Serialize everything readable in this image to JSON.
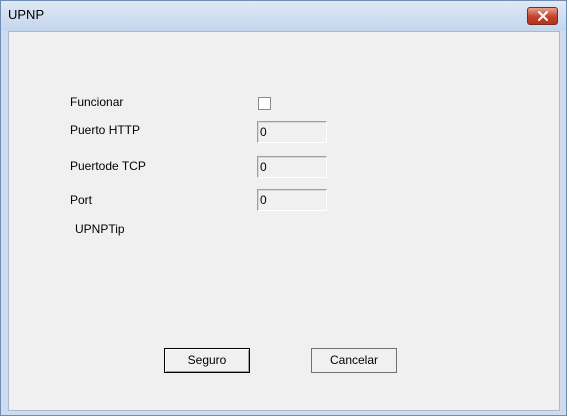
{
  "window": {
    "title": "UPNP",
    "close_icon": "close-icon"
  },
  "form": {
    "enable_label": "Funcionar",
    "enable_checked": false,
    "http_port_label": "Puerto HTTP",
    "http_port_value": "0",
    "tcp_port_label": "Puertode TCP",
    "tcp_port_value": "0",
    "port_label": "Port",
    "port_value": "0",
    "tip_text": "UPNPTip"
  },
  "buttons": {
    "ok_label": "Seguro",
    "cancel_label": "Cancelar"
  },
  "colors": {
    "titlebar": "#c4d5ec",
    "close_button": "#c4402b",
    "client_background": "#f0f0f0"
  }
}
